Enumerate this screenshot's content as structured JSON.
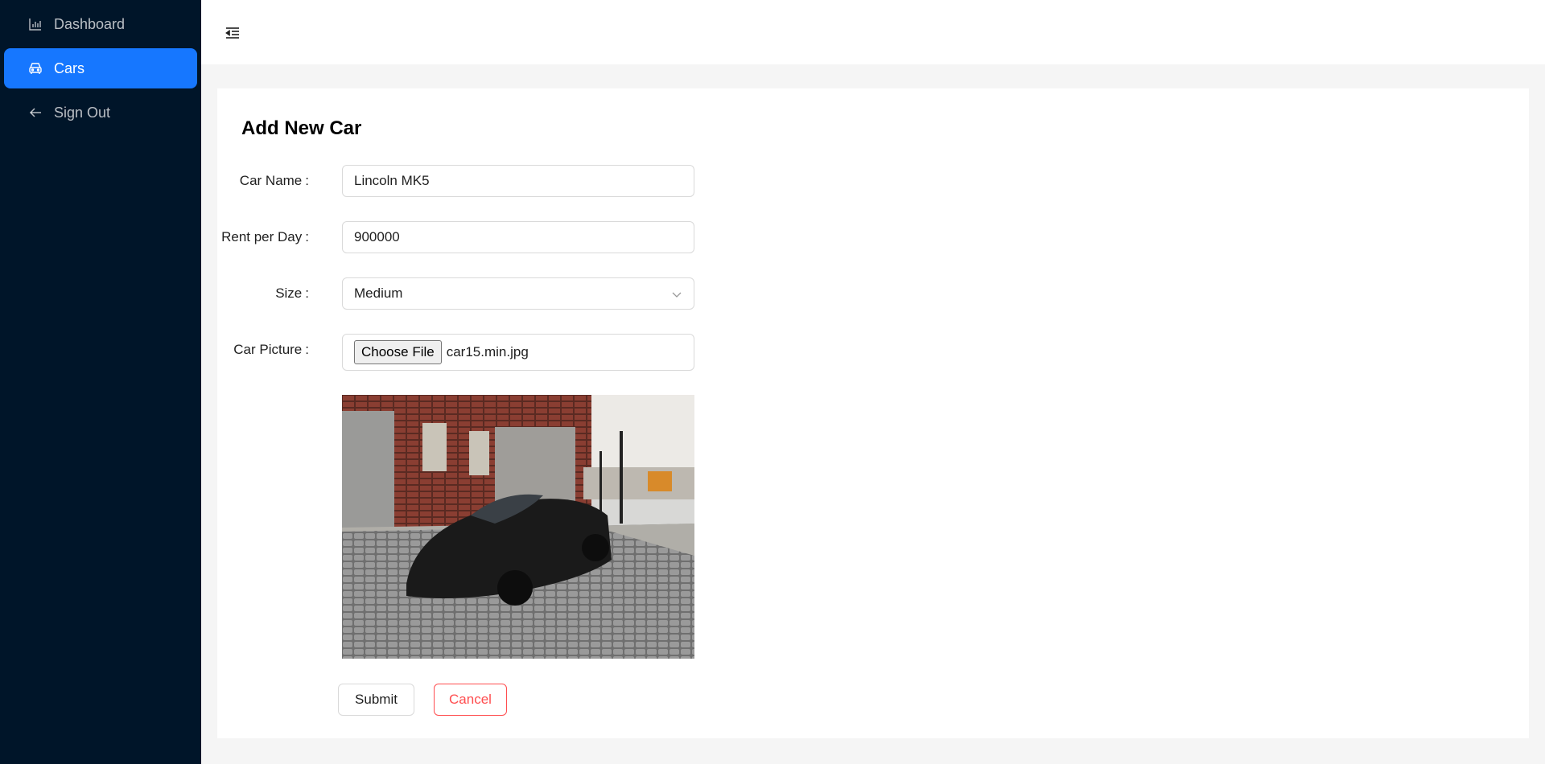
{
  "sidebar": {
    "items": [
      {
        "label": "Dashboard",
        "icon": "bar-chart-icon"
      },
      {
        "label": "Cars",
        "icon": "car-icon",
        "active": true
      },
      {
        "label": "Sign Out",
        "icon": "arrow-left-icon"
      }
    ]
  },
  "header": {
    "toggle_icon": "menu-fold-icon"
  },
  "form": {
    "title": "Add New Car",
    "car_name": {
      "label": "Car Name",
      "value": "Lincoln MK5"
    },
    "rent": {
      "label": "Rent per Day",
      "value": "900000"
    },
    "size": {
      "label": "Size",
      "value": "Medium"
    },
    "picture": {
      "label": "Car Picture",
      "button": "Choose File",
      "file_name": "car15.min.jpg"
    },
    "submit_label": "Submit",
    "cancel_label": "Cancel"
  },
  "colors": {
    "sidebar_bg": "#001529",
    "active_bg": "#1677ff",
    "cancel": "#ff4d4f"
  }
}
